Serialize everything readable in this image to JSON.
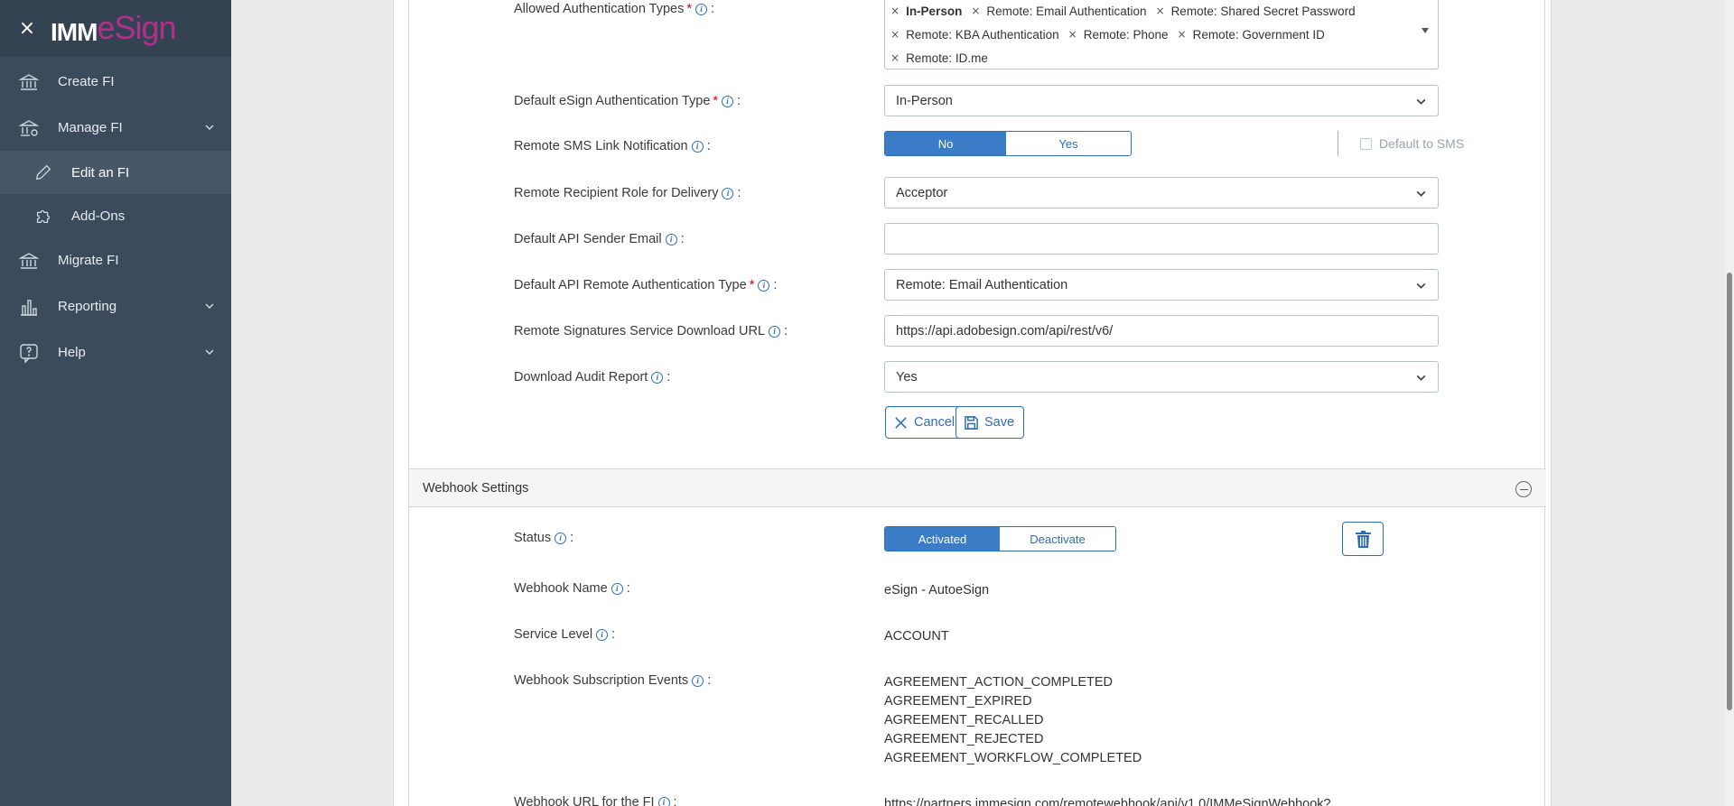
{
  "sidebar": {
    "logo_imm": "IMM",
    "logo_esign": "eSign",
    "items": [
      {
        "label": "Create FI"
      },
      {
        "label": "Manage FI"
      },
      {
        "label": "Edit an FI"
      },
      {
        "label": "Add-Ons"
      },
      {
        "label": "Migrate FI"
      },
      {
        "label": "Reporting"
      },
      {
        "label": "Help"
      }
    ]
  },
  "form": {
    "allowed_auth": {
      "label": "Allowed Authentication Types",
      "tags": [
        "In-Person",
        "Remote: Email Authentication",
        "Remote: Shared Secret Password",
        "Remote: KBA Authentication",
        "Remote: Phone",
        "Remote: Government ID",
        "Remote: ID.me"
      ]
    },
    "default_auth": {
      "label": "Default eSign Authentication Type",
      "value": "In-Person"
    },
    "sms_notification": {
      "label": "Remote SMS Link Notification",
      "option_no": "No",
      "option_yes": "Yes",
      "selected": "No",
      "default_sms_label": "Default to SMS"
    },
    "recipient_role": {
      "label": "Remote Recipient Role for Delivery",
      "value": "Acceptor"
    },
    "api_sender_email": {
      "label": "Default API Sender Email",
      "value": ""
    },
    "api_remote_auth": {
      "label": "Default API Remote Authentication Type",
      "value": "Remote: Email Authentication"
    },
    "download_url": {
      "label": "Remote Signatures Service Download URL",
      "value": "https://api.adobesign.com/api/rest/v6/"
    },
    "audit_report": {
      "label": "Download Audit Report",
      "value": "Yes"
    },
    "cancel_label": "Cancel",
    "save_label": "Save"
  },
  "webhook": {
    "section_title": "Webhook Settings",
    "status_label": "Status",
    "status_activated": "Activated",
    "status_deactivate": "Deactivate",
    "name_label": "Webhook Name",
    "name_value": "eSign - AutoeSign",
    "service_level_label": "Service Level",
    "service_level_value": "ACCOUNT",
    "events_label": "Webhook Subscription Events",
    "events": [
      "AGREEMENT_ACTION_COMPLETED",
      "AGREEMENT_EXPIRED",
      "AGREEMENT_RECALLED",
      "AGREEMENT_REJECTED",
      "AGREEMENT_WORKFLOW_COMPLETED"
    ],
    "url_label": "Webhook URL for the FI",
    "url_value": "https://partners.immesign.com/remotewebhook/api/v1.0/IMMeSignWebhook?"
  },
  "colors": {
    "sidebar_bg": "#3b4b5c",
    "accent": "#2f6db5",
    "brand_magenta": "#b0308a",
    "required": "#d0021b"
  },
  "icons": [
    "close-icon",
    "bank-icon",
    "bank-settings-icon",
    "pencil-icon",
    "puzzle-icon",
    "bank-migrate-icon",
    "bar-chart-icon",
    "help-bubble-icon",
    "chevron-down-icon",
    "info-icon",
    "x-icon",
    "save-icon",
    "trash-icon",
    "collapse-icon"
  ]
}
